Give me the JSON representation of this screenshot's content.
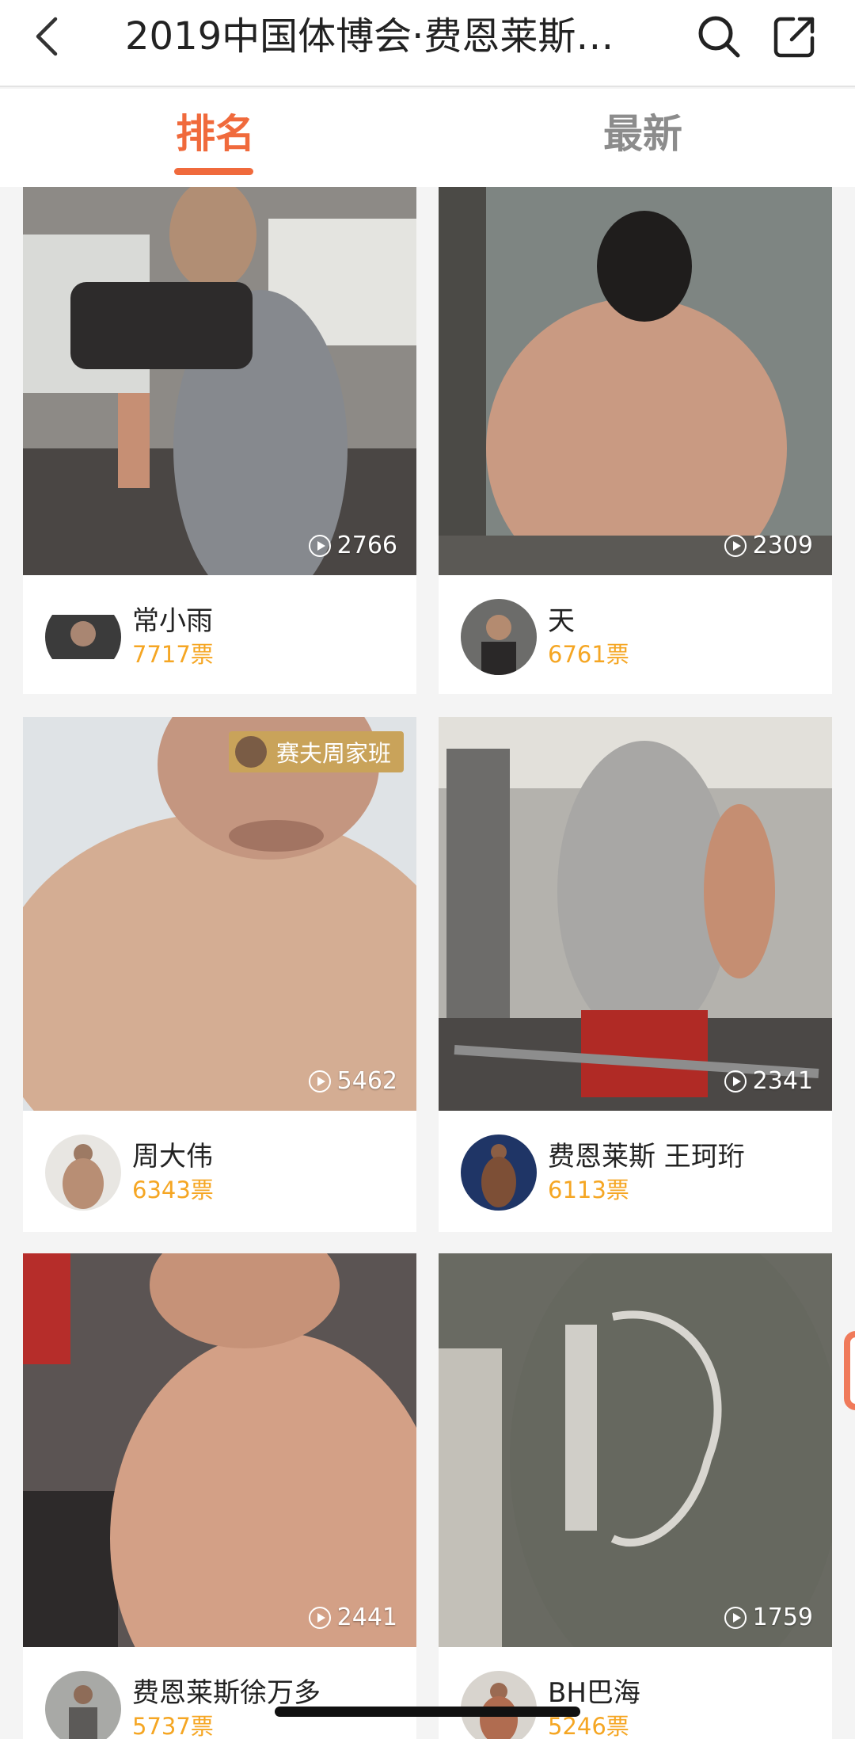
{
  "header": {
    "title": "2019中国体博会·费恩莱斯…"
  },
  "tabs": [
    {
      "label": "排名",
      "active": true
    },
    {
      "label": "最新",
      "active": false
    }
  ],
  "colors": {
    "accent": "#f06a3c",
    "votes": "#f5a623",
    "badge": "#c9a35a"
  },
  "cards": [
    {
      "name": "常小雨",
      "votes": "7717票",
      "plays": "2766"
    },
    {
      "name": "天",
      "votes": "6761票",
      "plays": "2309"
    },
    {
      "name": "周大伟",
      "votes": "6343票",
      "plays": "5462",
      "badge": "赛夫周家班"
    },
    {
      "name": "费恩莱斯 王珂珩",
      "votes": "6113票",
      "plays": "2341"
    },
    {
      "name": "费恩莱斯徐万多",
      "votes": "5737票",
      "plays": "2441"
    },
    {
      "name": "BH巴海",
      "votes": "5246票",
      "plays": "1759"
    }
  ]
}
